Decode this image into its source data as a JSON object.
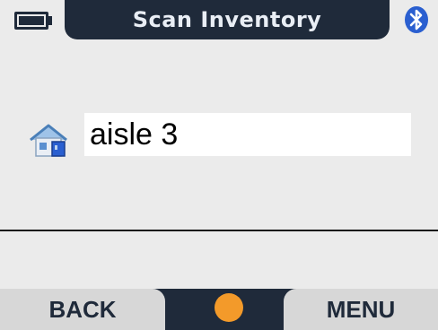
{
  "header": {
    "title": "Scan Inventory",
    "battery_icon": "battery-icon",
    "bluetooth_icon": "bluetooth-icon"
  },
  "main": {
    "location_icon": "home-icon",
    "location_value": "aisle 3"
  },
  "softkeys": {
    "left_label": "BACK",
    "center_icon": "center-select-dot",
    "right_label": "MENU"
  },
  "colors": {
    "header_bg": "#1f2a3a",
    "background": "#ebebeb",
    "accent": "#f39a2a",
    "bluetooth": "#2a5fd0"
  }
}
